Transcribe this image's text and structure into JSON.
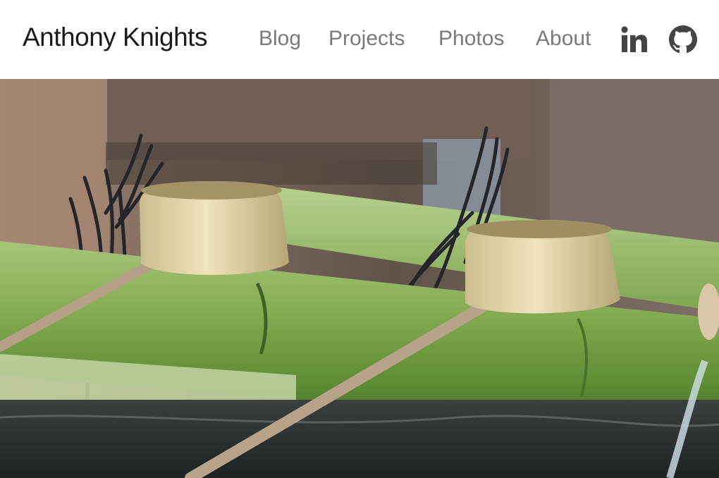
{
  "header": {
    "site_title": "Anthony Knights",
    "nav": [
      {
        "label": "Blog"
      },
      {
        "label": "Projects"
      },
      {
        "label": "Photos"
      },
      {
        "label": "About"
      }
    ],
    "social_icons": [
      "linkedin-icon",
      "github-icon"
    ]
  },
  "hero": {
    "image_subject": "bamboo water basin with two metal ladles"
  },
  "colors": {
    "title": "#1b1b1b",
    "nav_link": "#7a7a7a",
    "social_icon": "#444444",
    "background": "#ffffff"
  }
}
